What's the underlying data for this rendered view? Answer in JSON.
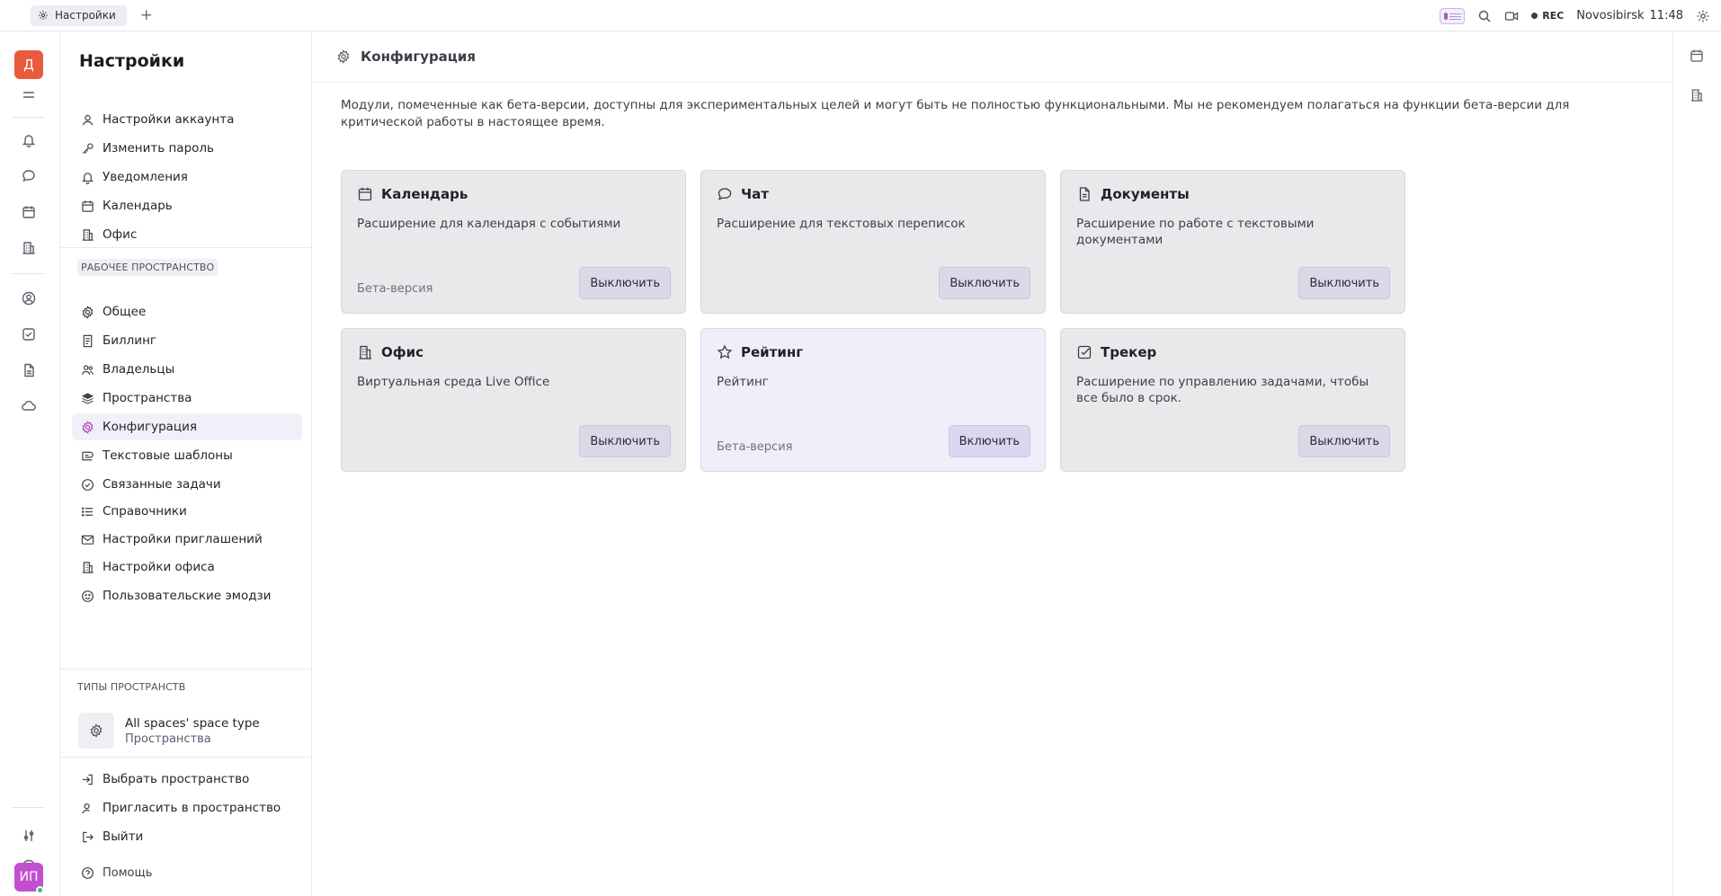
{
  "topbar": {
    "tab_label": "Настройки",
    "rec_label": "REC",
    "location": "Novosibirsk",
    "time": "11:48"
  },
  "rail": {
    "workspace_initial": "Д",
    "user_initials": "ИП"
  },
  "sidebar": {
    "title": "Настройки",
    "account_items": [
      {
        "label": "Настройки аккаунта",
        "icon": "user-icon"
      },
      {
        "label": "Изменить пароль",
        "icon": "key-icon"
      },
      {
        "label": "Уведомления",
        "icon": "bell-icon"
      },
      {
        "label": "Календарь",
        "icon": "calendar-icon"
      },
      {
        "label": "Офис",
        "icon": "office-icon"
      }
    ],
    "workspace_label": "РАБОЧЕЕ ПРОСТРАНСТВО",
    "workspace_items": [
      {
        "label": "Общее",
        "icon": "gear-icon"
      },
      {
        "label": "Биллинг",
        "icon": "receipt-icon"
      },
      {
        "label": "Владельцы",
        "icon": "owners-icon"
      },
      {
        "label": "Пространства",
        "icon": "layers-icon"
      },
      {
        "label": "Конфигурация",
        "icon": "gear-icon",
        "active": true
      },
      {
        "label": "Текстовые шаблоны",
        "icon": "template-icon"
      },
      {
        "label": "Связанные задачи",
        "icon": "check-circle-icon"
      },
      {
        "label": "Справочники",
        "icon": "list-icon"
      },
      {
        "label": "Настройки приглашений",
        "icon": "mail-icon"
      },
      {
        "label": "Настройки офиса",
        "icon": "office-icon"
      },
      {
        "label": "Пользовательские эмодзи",
        "icon": "emoji-icon"
      }
    ],
    "space_types_label": "ТИПЫ ПРОСТРАНСТВ",
    "space_type": {
      "name": "All spaces' space type",
      "subtitle": "Пространства"
    },
    "bottom_items": [
      {
        "label": "Выбрать пространство",
        "icon": "enter-icon"
      },
      {
        "label": "Пригласить в пространство",
        "icon": "invite-icon"
      },
      {
        "label": "Выйти",
        "icon": "logout-icon"
      }
    ],
    "help_label": "Помощь"
  },
  "main": {
    "title": "Конфигурация",
    "notice": "Модули, помеченные как бета-версии, доступны для экспериментальных целей и могут быть не полностью функциональными. Мы не рекомендуем полагаться на функции бета-версии для критической работы в настоящее время.",
    "modules": [
      {
        "title": "Календарь",
        "desc": "Расширение для календаря с событиями",
        "beta": "Бета-версия",
        "button": "Выключить",
        "enabled": true,
        "icon": "calendar-icon"
      },
      {
        "title": "Чат",
        "desc": "Расширение для текстовых переписок",
        "beta": "",
        "button": "Выключить",
        "enabled": true,
        "icon": "chat-icon"
      },
      {
        "title": "Документы",
        "desc": "Расширение по работе с текстовыми документами",
        "beta": "",
        "button": "Выключить",
        "enabled": true,
        "icon": "document-icon"
      },
      {
        "title": "Офис",
        "desc": "Виртуальная среда Live Office",
        "beta": "",
        "button": "Выключить",
        "enabled": true,
        "icon": "office-icon"
      },
      {
        "title": "Рейтинг",
        "desc": "Рейтинг",
        "beta": "Бета-версия",
        "button": "Включить",
        "enabled": false,
        "icon": "star-icon"
      },
      {
        "title": "Трекер",
        "desc": "Расширение по управлению задачами, чтобы все было в срок.",
        "beta": "",
        "button": "Выключить",
        "enabled": true,
        "icon": "check-square-icon"
      }
    ]
  }
}
